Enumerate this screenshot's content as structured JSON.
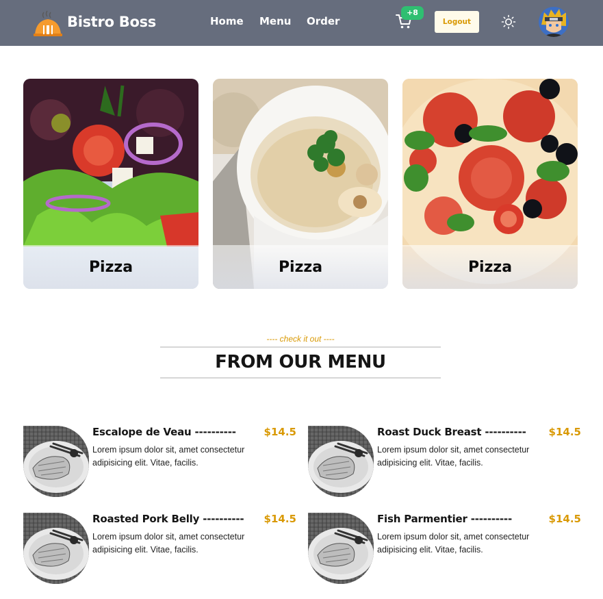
{
  "nav": {
    "brand": "Bistro Boss",
    "links": [
      "Home",
      "Menu",
      "Order"
    ],
    "cart_count": "+8",
    "logout_label": "Logout"
  },
  "categories": [
    {
      "label": "Pizza",
      "image": "salad-photo"
    },
    {
      "label": "Pizza",
      "image": "soup-photo"
    },
    {
      "label": "Pizza",
      "image": "pizza-photo"
    }
  ],
  "section": {
    "subheading": "---- check it out ----",
    "heading": "FROM OUR MENU"
  },
  "menu_items": [
    {
      "name": "Escalope de Veau ----------",
      "price": "$14.5",
      "description": "Lorem ipsum dolor sit, amet consectetur adipisicing elit. Vitae, facilis."
    },
    {
      "name": "Roast Duck Breast ----------",
      "price": "$14.5",
      "description": "Lorem ipsum dolor sit, amet consectetur adipisicing elit. Vitae, facilis."
    },
    {
      "name": "Roasted Pork Belly ----------",
      "price": "$14.5",
      "description": "Lorem ipsum dolor sit, amet consectetur adipisicing elit. Vitae, facilis."
    },
    {
      "name": "Fish Parmentier ----------",
      "price": "$14.5",
      "description": "Lorem ipsum dolor sit, amet consectetur adipisicing elit. Vitae, facilis."
    }
  ],
  "colors": {
    "navbar": "#666d7d",
    "accent": "#d99904",
    "badge": "#2fbf71"
  },
  "icons": [
    "restaurant-logo-icon",
    "cart-icon",
    "sun-icon",
    "avatar"
  ]
}
